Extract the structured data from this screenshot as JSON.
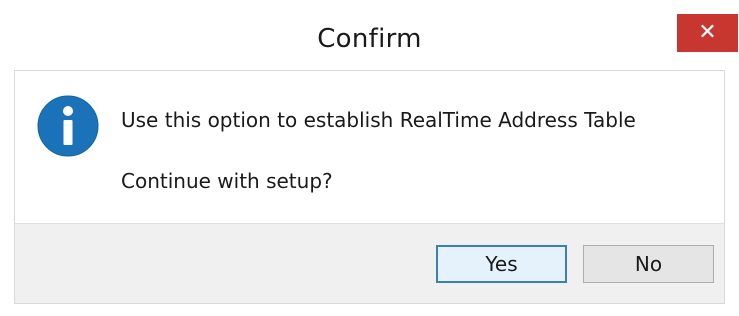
{
  "window": {
    "title": "Confirm",
    "close_label": "✕"
  },
  "message": {
    "icon": "info-icon",
    "line1": "Use this option to establish RealTime Address Table",
    "line2": "Continue with setup?"
  },
  "buttons": {
    "yes_label": "Yes",
    "no_label": "No"
  },
  "colors": {
    "close_button": "#c7372f",
    "info_icon": "#1a73b8",
    "default_button_border": "#3c7fb1"
  }
}
